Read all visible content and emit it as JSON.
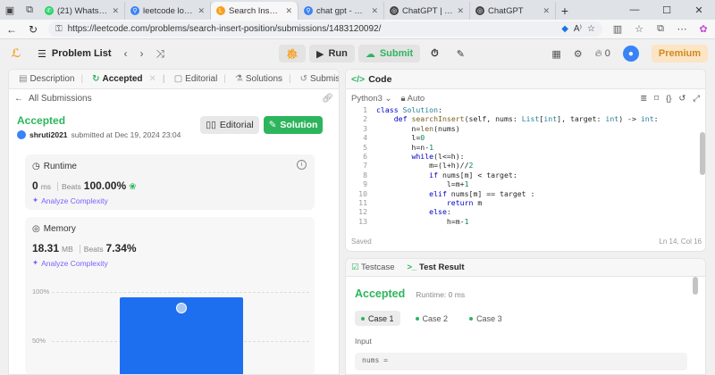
{
  "browser": {
    "tabs": [
      {
        "title": "(21) WhatsApp",
        "fav_color": "#25d366",
        "fav_glyph": "✆"
      },
      {
        "title": "leetcode login - S",
        "fav_color": "#3b82f6",
        "fav_glyph": "⚲"
      },
      {
        "title": "Search Insert Posi",
        "fav_color": "#f89f1b",
        "fav_glyph": "L"
      },
      {
        "title": "chat gpt - Search",
        "fav_color": "#3b82f6",
        "fav_glyph": "⚲"
      },
      {
        "title": "ChatGPT | OpenA",
        "fav_color": "#444444",
        "fav_glyph": "◎"
      },
      {
        "title": "ChatGPT",
        "fav_color": "#444444",
        "fav_glyph": "◎"
      }
    ],
    "url": "https://leetcode.com/problems/search-insert-position/submissions/1483120092/"
  },
  "header": {
    "problem_list": "Problem List",
    "run": "Run",
    "submit": "Submit",
    "coins": "0",
    "premium": "Premium"
  },
  "left": {
    "tabs": [
      {
        "label": "Description",
        "icon": "▤"
      },
      {
        "label": "Accepted",
        "icon": "↻"
      },
      {
        "label": "Editorial",
        "icon": "▢"
      },
      {
        "label": "Solutions",
        "icon": "⚗"
      },
      {
        "label": "Submissions",
        "icon": "↺"
      }
    ],
    "all_submissions": "All Submissions",
    "status": "Accepted",
    "username": "shruti2021",
    "submitted_text": "submitted at Dec 19, 2024 23:04",
    "editorial_btn": "Editorial",
    "solution_btn": "Solution",
    "runtime": {
      "label": "Runtime",
      "value": "0",
      "unit": "ms",
      "beats_label": "Beats",
      "beats": "100.00%",
      "analyze": "Analyze Complexity"
    },
    "memory": {
      "label": "Memory",
      "value": "18.31",
      "unit": "MB",
      "beats_label": "Beats",
      "beats": "7.34%",
      "analyze": "Analyze Complexity"
    }
  },
  "chart_data": {
    "type": "bar",
    "yticks": [
      "100%",
      "50%"
    ],
    "ylim": [
      0,
      100
    ],
    "values": [
      95
    ]
  },
  "code": {
    "title": "Code",
    "language": "Python3",
    "auto": "Auto",
    "saved": "Saved",
    "cursor": "Ln 14, Col 16",
    "lines": [
      "class Solution:",
      "    def searchInsert(self, nums: List[int], target: int) -> int:",
      "        n=len(nums)",
      "        l=0",
      "        h=n-1",
      "        while(l<=h):",
      "            m=(l+h)//2",
      "            if nums[m] < target:",
      "                l=m+1",
      "            elif nums[m] == target :",
      "                return m",
      "            else:",
      "                h=m-1"
    ]
  },
  "test": {
    "testcase_tab": "Testcase",
    "result_tab": "Test Result",
    "status": "Accepted",
    "runtime": "Runtime: 0 ms",
    "cases": [
      "Case 1",
      "Case 2",
      "Case 3"
    ],
    "input_label": "Input",
    "input_value": "nums ="
  }
}
